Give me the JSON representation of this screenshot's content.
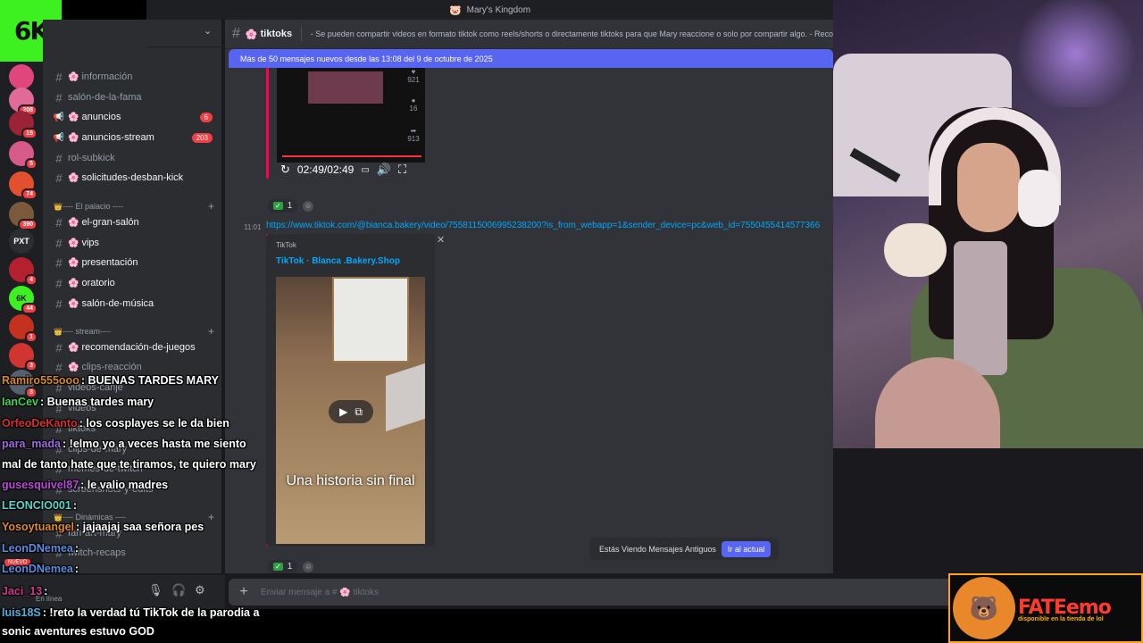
{
  "window": {
    "title": "Mary's Kingdom"
  },
  "logo": {
    "text": "6K"
  },
  "servers": [
    {
      "label": "",
      "color": "#e0457b",
      "badge": ""
    },
    {
      "label": "",
      "color": "#e06b9a",
      "badge": "208"
    },
    {
      "label": "",
      "color": "#9b2335",
      "badge": "15"
    },
    {
      "label": "",
      "color": "#d65a8a",
      "badge": "5"
    },
    {
      "label": "",
      "color": "#e2502e",
      "badge": "74"
    },
    {
      "label": "",
      "color": "#7a5a3a",
      "badge": "390"
    },
    {
      "label": "PXT",
      "color": "#2b2d31",
      "badge": ""
    },
    {
      "label": "",
      "color": "#b3202e",
      "badge": "4"
    },
    {
      "label": "6K",
      "color": "#3df01f",
      "badge": "44"
    },
    {
      "label": "",
      "color": "#c4321f",
      "badge": "1"
    },
    {
      "label": "",
      "color": "#d2352f",
      "badge": "3"
    },
    {
      "label": "",
      "color": "#55616e",
      "badge": "3"
    }
  ],
  "sidebar": {
    "channels": [
      {
        "name": "información",
        "flower": true,
        "unread": false,
        "badge": ""
      },
      {
        "name": "salón-de-la-fama",
        "flower": false,
        "unread": false,
        "badge": ""
      },
      {
        "name": "anuncios",
        "flower": true,
        "unread": true,
        "badge": "6",
        "icon": "megaphone"
      },
      {
        "name": "anuncios-stream",
        "flower": true,
        "unread": true,
        "badge": "203",
        "icon": "megaphone"
      },
      {
        "name": "rol-subkick",
        "flower": false,
        "unread": false,
        "badge": ""
      },
      {
        "name": "solicitudes-desban-kick",
        "flower": true,
        "unread": true,
        "badge": ""
      }
    ],
    "categories": [
      {
        "label": "---- El palacio ----"
      },
      {
        "label": "---- stream----"
      },
      {
        "label": "---- Dinámicas ----"
      }
    ],
    "palacio_channels": [
      {
        "name": "el-gran-salón",
        "flower": true,
        "unread": true
      },
      {
        "name": "vips",
        "flower": true,
        "unread": true
      },
      {
        "name": "presentación",
        "flower": true,
        "unread": true
      },
      {
        "name": "oratorio",
        "flower": true,
        "unread": true
      },
      {
        "name": "salón-de-música",
        "flower": true,
        "unread": true
      }
    ],
    "stream_channels": [
      {
        "name": "recomendación-de-juegos",
        "flower": true,
        "unread": true
      },
      {
        "name": "clips-reacción",
        "flower": true,
        "unread": false
      },
      {
        "name": "videos-canje",
        "flower": false,
        "unread": false
      },
      {
        "name": "videos",
        "flower": false,
        "unread": false
      },
      {
        "name": "tiktoks",
        "flower": false,
        "unread": false
      },
      {
        "name": "clips-de-mary",
        "flower": false,
        "unread": false
      },
      {
        "name": "memes-de-twitch",
        "flower": false,
        "unread": false
      },
      {
        "name": "screenshots-y-edits",
        "flower": false,
        "unread": false
      }
    ],
    "dinamicas_channels": [
      {
        "name": "fan-art-mary",
        "flower": false,
        "unread": false
      },
      {
        "name": "twitch-recaps",
        "flower": false,
        "unread": false
      }
    ]
  },
  "userpanel": {
    "status": "En línea",
    "new_label": "NUEVO"
  },
  "channel": {
    "name": "tiktoks",
    "topic": "- Se pueden compartir videos en formato tiktok como reels/shorts o directamente tiktoks para que Mary reaccione o solo por compartir algo. - Reco"
  },
  "new_messages_bar": "Más de 50 mensajes nuevos desde las 13:08 del 9 de octubre de 2025",
  "video1": {
    "time": "02:49/02:49",
    "progress": 1.0,
    "stats": [
      "921",
      "16",
      "913"
    ]
  },
  "reactions": [
    {
      "check": "✓",
      "count": "1"
    },
    {
      "check": "✓",
      "count": "1"
    }
  ],
  "message": {
    "time": "11:01",
    "link": "https://www.tiktok.com/@bianca.bakery/video/7558115006995238200?is_from_webapp=1&sender_device=pc&web_id=7550455414577366"
  },
  "embed": {
    "site": "TikTok",
    "title": "TikTok · Blanca .Bakery.Shop",
    "caption": "Una historia sin final"
  },
  "jump_bar": {
    "text": "Estás Viendo Mensajes Antiguos",
    "button": "Ir al actual"
  },
  "composer": {
    "placeholder": "Enviar mensaje a # 🌸 tiktoks"
  },
  "stream_chat": [
    {
      "user": "Ramiro555ooo",
      "color": "#d7892a",
      "text": ": BUENAS TARDES MARY"
    },
    {
      "user": "IanCev",
      "color": "#3fd45a",
      "text": ": Buenas tardes mary"
    },
    {
      "user": "OrfeoDeKanto",
      "color": "#d62f2f",
      "text": ": los cosplayes se le da bien"
    },
    {
      "user": "para_mada",
      "color": "#a06ae0",
      "text": ": !elmo yo a veces hasta me siento"
    },
    {
      "user": "",
      "color": "#ffffff",
      "text": "mal de tanto hate que te tiramos, te quiero mary"
    },
    {
      "user": "gusesquivel87",
      "color": "#b84cd8",
      "text": ": le valio madres"
    },
    {
      "user": "LEONCIO001",
      "color": "#5fd3c9",
      "text": ":"
    },
    {
      "user": "Yosoytuangel",
      "color": "#e08a2a",
      "text": ": jajaajaj saa señora pes"
    },
    {
      "user": "LeonDNemea",
      "color": "#5b8de0",
      "text": ":"
    },
    {
      "user": "LeonDNemea",
      "color": "#5b8de0",
      "text": ":"
    },
    {
      "user": "Jaci_13",
      "color": "#d03a8a",
      "text": ":"
    },
    {
      "user": "luis18S",
      "color": "#4fb0e0",
      "text": ": !reto la verdad tú TikTok de la parodia a"
    },
    {
      "user": "",
      "color": "#ffffff",
      "text": "sonic aventures estuvo GOD"
    }
  ],
  "sponsor": {
    "name": "FATEemo",
    "subtitle": "disponible en la tienda de lol"
  }
}
